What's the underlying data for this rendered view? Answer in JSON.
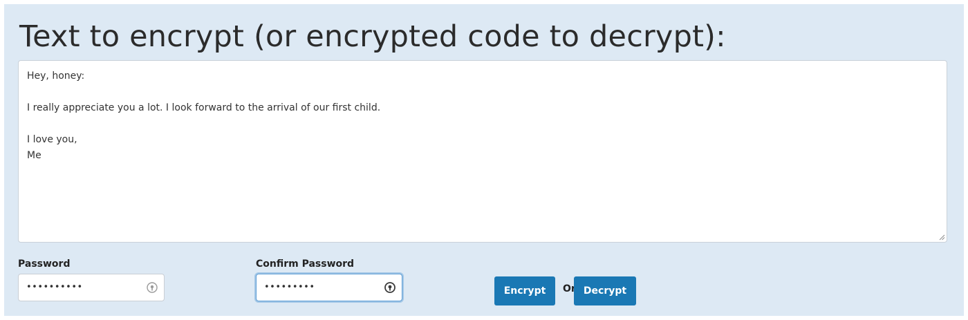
{
  "heading": "Text to encrypt (or encrypted code to decrypt):",
  "message": {
    "value": "Hey, honey:\n\nI really appreciate you a lot. I look forward to the arrival of our first child.\n\nI love you,\nMe"
  },
  "password": {
    "label": "Password",
    "masked_value": "••••••••••",
    "icon": "password-manager-icon"
  },
  "confirm_password": {
    "label": "Confirm Password",
    "masked_value": "•••••••••",
    "icon": "password-manager-icon"
  },
  "actions": {
    "encrypt_label": "Encrypt",
    "separator": "Or",
    "decrypt_label": "Decrypt"
  },
  "colors": {
    "panel_background": "#dde9f4",
    "button_background": "#1a78b4",
    "focus_ring": "#5d9dd5"
  }
}
